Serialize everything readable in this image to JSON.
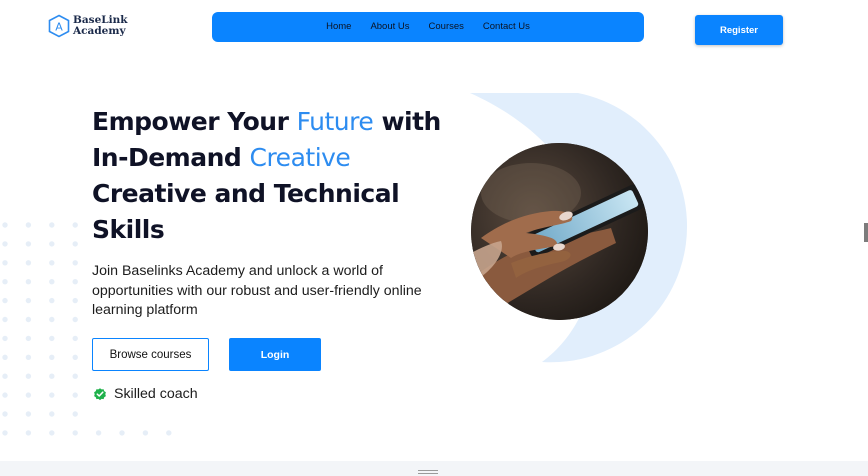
{
  "brand": {
    "logo_letter": "A",
    "name_line1": "BaseLink",
    "name_line2": "Academy"
  },
  "nav": {
    "items": [
      "Home",
      "About Us",
      "Courses",
      "Contact Us"
    ]
  },
  "header": {
    "register_label": "Register"
  },
  "hero": {
    "title_part1": "Empower Your ",
    "title_accent1": "Future",
    "title_part2": " with",
    "title_part3": "In-Demand ",
    "title_accent2": "Creative",
    "title_part4": "Creative and Technical",
    "title_part5": "Skills",
    "description": "Join Baselinks Academy and unlock a world of opportunities with our robust and user-friendly online learning platform",
    "browse_label": "Browse courses",
    "login_label": "Login",
    "badge_text": "Skilled coach"
  },
  "colors": {
    "primary": "#0a84ff",
    "accent_text": "#2d8cf0",
    "shape": "#e1eefc",
    "dots": "#e6eef7",
    "check": "#1fb14b"
  },
  "icons": {
    "logo": "hexagon-a-icon",
    "badge": "verified-check-icon"
  }
}
